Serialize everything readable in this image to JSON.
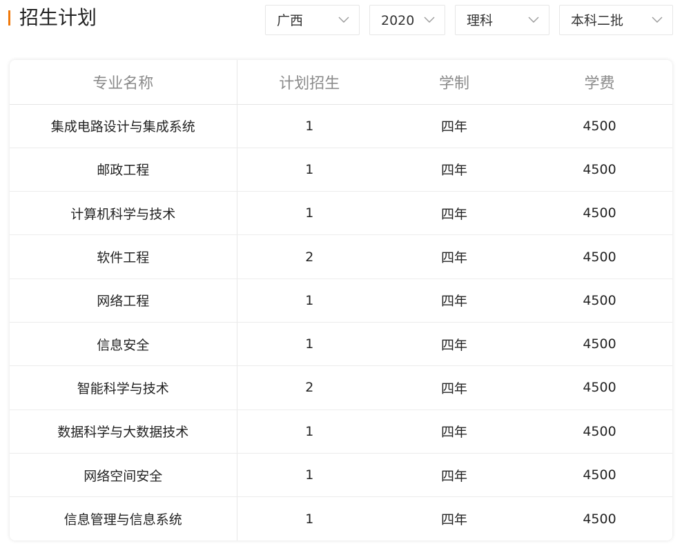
{
  "header": {
    "title": "招生计划"
  },
  "filters": {
    "province": "广西",
    "year": "2020",
    "subject": "理科",
    "batch": "本科二批"
  },
  "table": {
    "columns": [
      "专业名称",
      "计划招生",
      "学制",
      "学费"
    ],
    "rows": [
      {
        "major": "集成电路设计与集成系统",
        "plan": "1",
        "duration": "四年",
        "tuition": "4500"
      },
      {
        "major": "邮政工程",
        "plan": "1",
        "duration": "四年",
        "tuition": "4500"
      },
      {
        "major": "计算机科学与技术",
        "plan": "1",
        "duration": "四年",
        "tuition": "4500"
      },
      {
        "major": "软件工程",
        "plan": "2",
        "duration": "四年",
        "tuition": "4500"
      },
      {
        "major": "网络工程",
        "plan": "1",
        "duration": "四年",
        "tuition": "4500"
      },
      {
        "major": "信息安全",
        "plan": "1",
        "duration": "四年",
        "tuition": "4500"
      },
      {
        "major": "智能科学与技术",
        "plan": "2",
        "duration": "四年",
        "tuition": "4500"
      },
      {
        "major": "数据科学与大数据技术",
        "plan": "1",
        "duration": "四年",
        "tuition": "4500"
      },
      {
        "major": "网络空间安全",
        "plan": "1",
        "duration": "四年",
        "tuition": "4500"
      },
      {
        "major": "信息管理与信息系统",
        "plan": "1",
        "duration": "四年",
        "tuition": "4500"
      }
    ]
  },
  "colors": {
    "accent": "#f0780a",
    "header_text": "#8a8a8a",
    "border": "#e5e5e5"
  },
  "icons": {
    "dropdown": "chevron-down-icon"
  }
}
